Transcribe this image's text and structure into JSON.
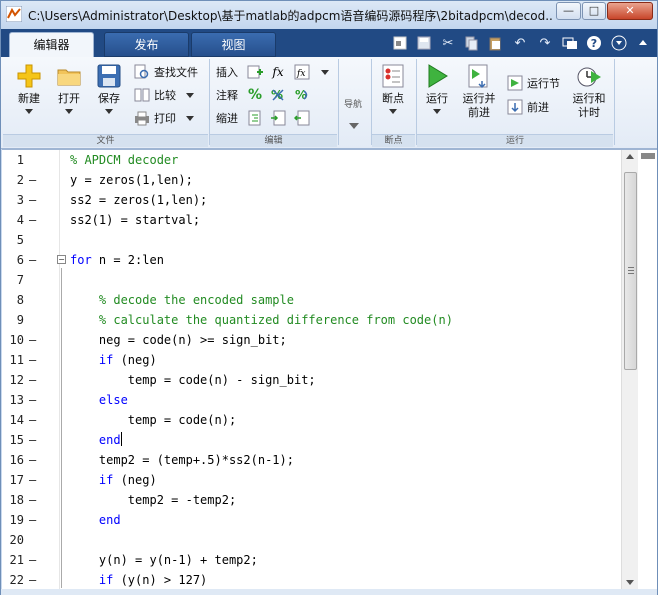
{
  "window": {
    "title": "C:\\Users\\Administrator\\Desktop\\基于matlab的adpcm语音编码源码程序\\2bitadpcm\\decod...",
    "minimize": "—",
    "maximize": "□",
    "close": "✕"
  },
  "tabs": [
    {
      "label": "编辑器"
    },
    {
      "label": "发布"
    },
    {
      "label": "视图"
    }
  ],
  "ribbon": {
    "file": {
      "section": "文件",
      "new": "新建",
      "open": "打开",
      "save": "保存",
      "find_files": "查找文件",
      "compare": "比较",
      "print": "打印"
    },
    "edit": {
      "section": "编辑",
      "insert": "插入",
      "comment": "注释",
      "indent": "缩进",
      "fx": "fx"
    },
    "navigate": {
      "label": "导航"
    },
    "breakpoints": {
      "section": "断点",
      "breakpoints": "断点"
    },
    "run": {
      "section": "运行",
      "run": "运行",
      "run_advance": "运行并\n前进",
      "run_section": "运行节",
      "advance": "前进",
      "run_time": "运行和\n计时"
    }
  },
  "editor": {
    "lines": [
      {
        "n": "1",
        "dash": "",
        "indent": "",
        "parts": [
          {
            "t": "% APDCM decoder",
            "c": "cm"
          }
        ]
      },
      {
        "n": "2",
        "dash": "—",
        "indent": "",
        "parts": [
          {
            "t": "y = zeros(1,len);",
            "c": ""
          }
        ]
      },
      {
        "n": "3",
        "dash": "—",
        "indent": "",
        "parts": [
          {
            "t": "ss2 = zeros(1,len);",
            "c": ""
          }
        ]
      },
      {
        "n": "4",
        "dash": "—",
        "indent": "",
        "parts": [
          {
            "t": "ss2(1) = startval;",
            "c": ""
          }
        ]
      },
      {
        "n": "5",
        "dash": "",
        "indent": "",
        "parts": []
      },
      {
        "n": "6",
        "dash": "—",
        "indent": "",
        "parts": [
          {
            "t": "for",
            "c": "kw"
          },
          {
            "t": " n = 2:len",
            "c": ""
          }
        ]
      },
      {
        "n": "7",
        "dash": "",
        "indent": "",
        "parts": []
      },
      {
        "n": "8",
        "dash": "",
        "indent": "    ",
        "parts": [
          {
            "t": "% decode the encoded sample",
            "c": "cm"
          }
        ]
      },
      {
        "n": "9",
        "dash": "",
        "indent": "    ",
        "parts": [
          {
            "t": "% calculate the quantized difference from code(n)",
            "c": "cm"
          }
        ]
      },
      {
        "n": "10",
        "dash": "—",
        "indent": "    ",
        "parts": [
          {
            "t": "neg = code(n) >= sign_bit;",
            "c": ""
          }
        ]
      },
      {
        "n": "11",
        "dash": "—",
        "indent": "    ",
        "parts": [
          {
            "t": "if",
            "c": "kw"
          },
          {
            "t": " (neg)",
            "c": ""
          }
        ]
      },
      {
        "n": "12",
        "dash": "—",
        "indent": "        ",
        "parts": [
          {
            "t": "temp = code(n) - sign_bit;",
            "c": ""
          }
        ]
      },
      {
        "n": "13",
        "dash": "—",
        "indent": "    ",
        "parts": [
          {
            "t": "else",
            "c": "kw"
          }
        ]
      },
      {
        "n": "14",
        "dash": "—",
        "indent": "        ",
        "parts": [
          {
            "t": "temp = code(n);",
            "c": ""
          }
        ]
      },
      {
        "n": "15",
        "dash": "—",
        "indent": "    ",
        "parts": [
          {
            "t": "end",
            "c": "kw"
          }
        ],
        "cursor": true
      },
      {
        "n": "16",
        "dash": "—",
        "indent": "    ",
        "parts": [
          {
            "t": "temp2 = (temp+.5)*ss2(n-1);",
            "c": ""
          }
        ]
      },
      {
        "n": "17",
        "dash": "—",
        "indent": "    ",
        "parts": [
          {
            "t": "if",
            "c": "kw"
          },
          {
            "t": " (neg)",
            "c": ""
          }
        ]
      },
      {
        "n": "18",
        "dash": "—",
        "indent": "        ",
        "parts": [
          {
            "t": "temp2 = -temp2;",
            "c": ""
          }
        ]
      },
      {
        "n": "19",
        "dash": "—",
        "indent": "    ",
        "parts": [
          {
            "t": "end",
            "c": "kw"
          }
        ]
      },
      {
        "n": "20",
        "dash": "",
        "indent": "",
        "parts": []
      },
      {
        "n": "21",
        "dash": "—",
        "indent": "    ",
        "parts": [
          {
            "t": "y(n) = y(n-1) + temp2;",
            "c": ""
          }
        ]
      },
      {
        "n": "22",
        "dash": "—",
        "indent": "    ",
        "parts": [
          {
            "t": "if",
            "c": "kw"
          },
          {
            "t": " (y(n) > 127)",
            "c": ""
          }
        ]
      }
    ]
  }
}
